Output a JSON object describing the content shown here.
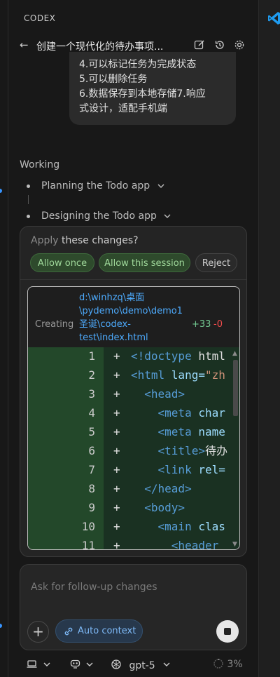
{
  "panel": {
    "title": "CODEX"
  },
  "header": {
    "title": "创建一个现代化的待办事项...",
    "back_icon": "arrow-left-icon",
    "edit_icon": "edit-icon",
    "history_icon": "history-icon",
    "settings_icon": "gear-icon"
  },
  "user_message": {
    "lines": [
      "4.可以标记任务为完成状态",
      "5.可以删除任务",
      "6.数据保存到本地存储7.响应",
      "式设计，适配手机端"
    ]
  },
  "status": {
    "label": "Working",
    "steps": [
      {
        "label": "Planning the Todo app"
      },
      {
        "label": "Designing the Todo app"
      }
    ]
  },
  "approval": {
    "question_faded": "Apply ",
    "question_main": "these changes?",
    "allow_once": "Allow once",
    "allow_session": "Allow this session",
    "reject": "Reject"
  },
  "diff": {
    "action": "Creating",
    "path_lines": [
      "d:\\winhzq\\桌面",
      "\\pydemo\\demo\\demo1",
      "圣诞\\codex-",
      "test\\index.html"
    ],
    "added": "+33",
    "removed": "-0",
    "lines": [
      {
        "num": "1",
        "sign": "+",
        "indent": "",
        "tag1": "<!doctype ",
        "attr": "",
        "rest": "html"
      },
      {
        "num": "2",
        "sign": "+",
        "indent": "",
        "tag1": "<html ",
        "attr": "lang=",
        "rest": "\"zh"
      },
      {
        "num": "3",
        "sign": "+",
        "indent": "  ",
        "tag1": "<head>",
        "attr": "",
        "rest": ""
      },
      {
        "num": "4",
        "sign": "+",
        "indent": "    ",
        "tag1": "<meta ",
        "attr": "char",
        "rest": ""
      },
      {
        "num": "5",
        "sign": "+",
        "indent": "    ",
        "tag1": "<meta ",
        "attr": "name",
        "rest": ""
      },
      {
        "num": "6",
        "sign": "+",
        "indent": "    ",
        "tag1": "<title>",
        "attr": "",
        "rest": "待办"
      },
      {
        "num": "7",
        "sign": "+",
        "indent": "    ",
        "tag1": "<link ",
        "attr": "rel=",
        "rest": ""
      },
      {
        "num": "8",
        "sign": "+",
        "indent": "  ",
        "tag1": "</head>",
        "attr": "",
        "rest": ""
      },
      {
        "num": "9",
        "sign": "+",
        "indent": "  ",
        "tag1": "<body>",
        "attr": "",
        "rest": ""
      },
      {
        "num": "10",
        "sign": "+",
        "indent": "    ",
        "tag1": "<main ",
        "attr": "clas",
        "rest": ""
      },
      {
        "num": "11",
        "sign": "+",
        "indent": "      ",
        "tag1": "<header",
        "attr": "",
        "rest": ""
      }
    ]
  },
  "composer": {
    "placeholder": "Ask for follow-up changes",
    "context_label": "Auto context"
  },
  "footer": {
    "model": "gpt-5",
    "usage": "3%"
  },
  "colors": {
    "accent": "#3794ff",
    "added": "#73c991",
    "removed": "#f14c4c",
    "allow_green": "#9fd89a"
  }
}
